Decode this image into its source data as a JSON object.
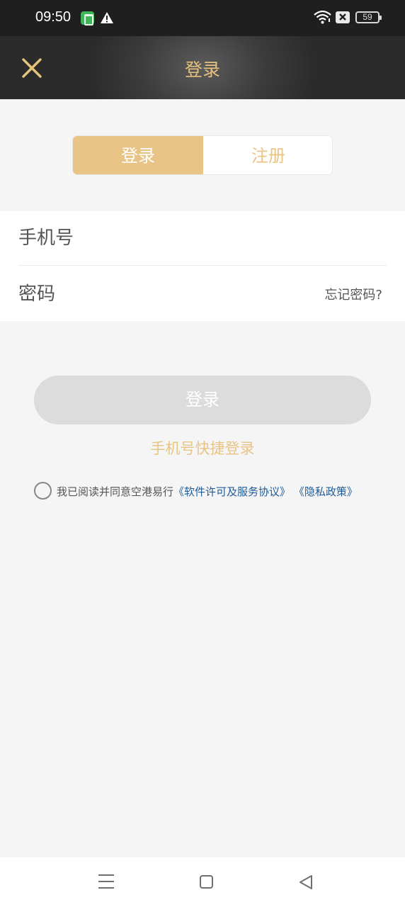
{
  "status_bar": {
    "time": "09:50",
    "battery_level": "59",
    "icons": [
      "app-notification-icon",
      "warning-icon",
      "wifi-icon",
      "no-sim-icon",
      "battery-icon"
    ]
  },
  "header": {
    "title": "登录",
    "close_icon": "close-icon"
  },
  "tabs": {
    "login": "登录",
    "register": "注册",
    "active": "login"
  },
  "form": {
    "phone_placeholder": "手机号",
    "password_placeholder": "密码",
    "forgot_password": "忘记密码?"
  },
  "actions": {
    "login_button": "登录",
    "quick_login": "手机号快捷登录"
  },
  "agreement": {
    "prefix": "我已阅读并同意空港易行",
    "license_link": "《软件许可及服务协议》",
    "privacy_link": "《隐私政策》",
    "checked": false
  },
  "colors": {
    "accent": "#e8c586",
    "link": "#1f5b99",
    "disabled_button": "#dcdcdc",
    "header_bg": "#3c3c3c"
  },
  "navbar": {
    "icons": [
      "menu-icon",
      "home-icon",
      "back-icon"
    ]
  }
}
